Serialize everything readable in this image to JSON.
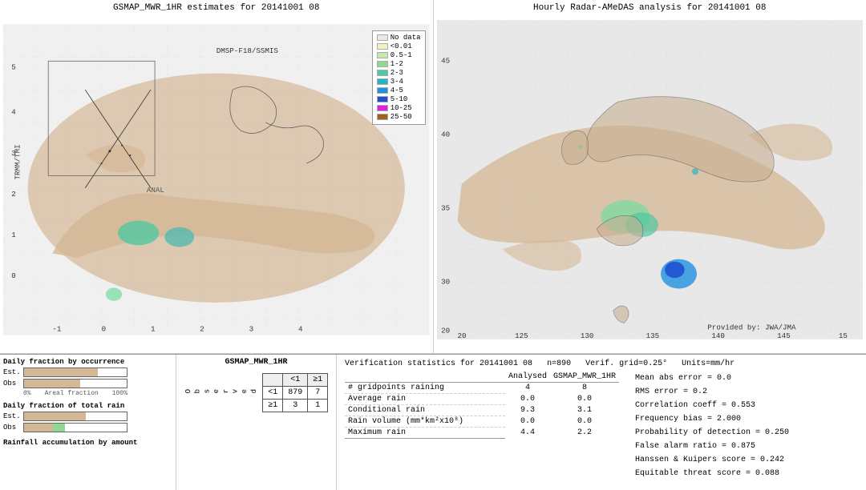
{
  "leftMap": {
    "title": "GSMAP_MWR_1HR estimates for 20141001 08",
    "subtitle": "DMSP-F18/SSMIS",
    "label_trmm": "TRMM/TMI",
    "label_anal": "ANAL"
  },
  "rightMap": {
    "title": "Hourly Radar-AMeDAS analysis for 20141001 08",
    "credit": "Provided by: JWA/JMA"
  },
  "legend": {
    "items": [
      {
        "label": "No data",
        "color": "#e8e8e8"
      },
      {
        "label": "<0.01",
        "color": "#f5f0c0"
      },
      {
        "label": "0.5-1",
        "color": "#c8e8b0"
      },
      {
        "label": "1-2",
        "color": "#90d890"
      },
      {
        "label": "2-3",
        "color": "#50c8a0"
      },
      {
        "label": "3-4",
        "color": "#20b8c0"
      },
      {
        "label": "4-5",
        "color": "#2090e0"
      },
      {
        "label": "5-10",
        "color": "#2050d0"
      },
      {
        "label": "10-25",
        "color": "#e020e0"
      },
      {
        "label": "25-50",
        "color": "#a06020"
      }
    ]
  },
  "bottomLeft": {
    "section1_title": "Daily fraction by occurrence",
    "est_label": "Est.",
    "obs_label": "Obs",
    "pct_0": "0%",
    "pct_100": "100%",
    "areal_fraction": "Areal fraction",
    "section2_title": "Daily fraction of total rain",
    "section3_title": "Rainfall accumulation by amount",
    "est_bar1_pct": 72,
    "obs_bar1_pct": 55,
    "est_bar2_pct": 60,
    "obs_bar2_pct": 40
  },
  "contingency": {
    "title": "GSMAP_MWR_1HR",
    "col_lt1": "<1",
    "col_ge1": "≥1",
    "row_lt1": "<1",
    "row_ge1": "≥1",
    "v11": "879",
    "v12": "7",
    "v21": "3",
    "v22": "1",
    "obs_label": "O\nb\ns\ne\nr\nv\ne\nd"
  },
  "verification": {
    "title": "Verification statistics for 20141001 08",
    "n": "n=890",
    "verif_grid": "Verif. grid=0.25°",
    "units": "Units=mm/hr",
    "col_analysed": "Analysed",
    "col_gsmap": "GSMAP_MWR_1HR",
    "rows": [
      {
        "label": "# gridpoints raining",
        "analysed": "4",
        "gsmap": "8"
      },
      {
        "label": "Average rain",
        "analysed": "0.0",
        "gsmap": "0.0"
      },
      {
        "label": "Conditional rain",
        "analysed": "9.3",
        "gsmap": "3.1"
      },
      {
        "label": "Rain volume (mm*km²x10⁸)",
        "analysed": "0.0",
        "gsmap": "0.0"
      },
      {
        "label": "Maximum rain",
        "analysed": "4.4",
        "gsmap": "2.2"
      }
    ],
    "metrics": [
      {
        "label": "Mean abs error = 0.0"
      },
      {
        "label": "RMS error = 0.2"
      },
      {
        "label": "Correlation coeff = 0.553"
      },
      {
        "label": "Frequency bias = 2.000"
      },
      {
        "label": "Probability of detection = 0.250"
      },
      {
        "label": "False alarm ratio = 0.875"
      },
      {
        "label": "Hanssen & Kuipers score = 0.242"
      },
      {
        "label": "Equitable threat score = 0.088"
      }
    ]
  }
}
